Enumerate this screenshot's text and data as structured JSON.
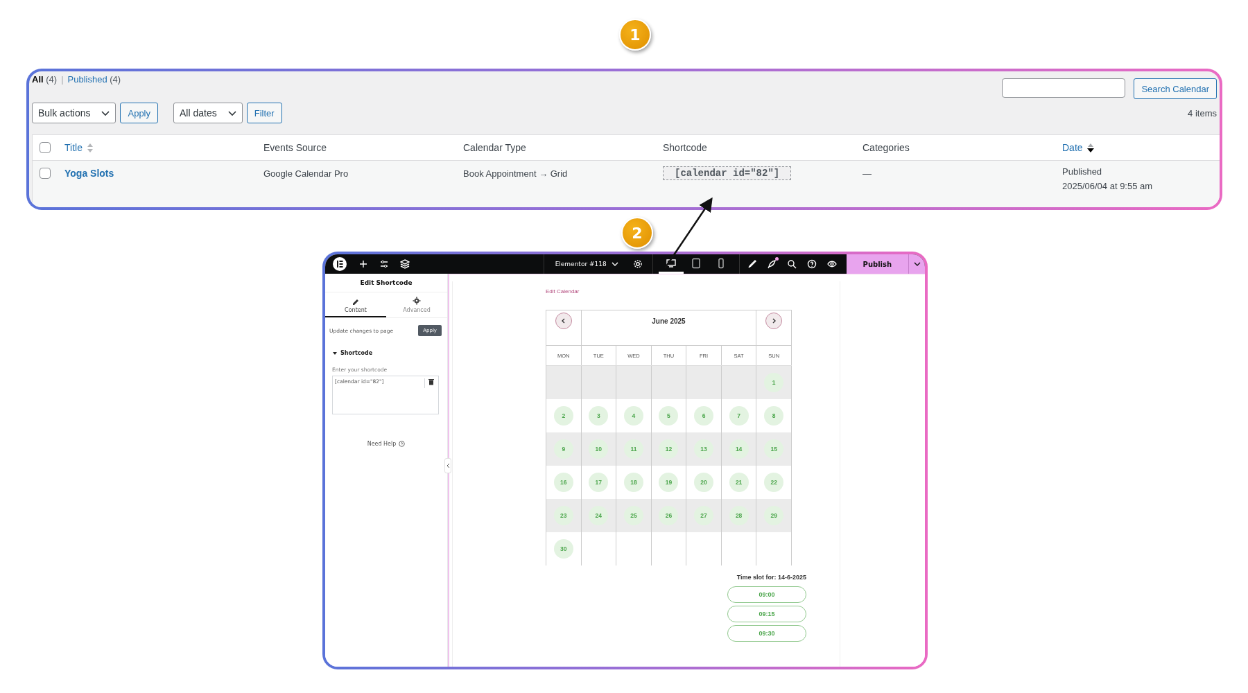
{
  "callouts": [
    {
      "number": "1"
    },
    {
      "number": "2"
    }
  ],
  "list_table": {
    "views": [
      {
        "label": "All",
        "count": "(4)",
        "selected": true
      },
      {
        "label": "Published",
        "count": "(4)",
        "selected": false
      }
    ],
    "view_separator": "|",
    "search_button": "Search Calendar",
    "bulk_select": "Bulk actions",
    "apply_button": "Apply",
    "date_select": "All dates",
    "filter_button": "Filter",
    "items_count": "4 items",
    "columns": [
      {
        "kind": "checkbox",
        "checked": false
      },
      {
        "kind": "text",
        "label": "Title",
        "sortable": true,
        "sorted": false
      },
      {
        "kind": "text",
        "label": "Events Source",
        "sortable": false
      },
      {
        "kind": "text",
        "label": "Calendar Type",
        "sortable": false
      },
      {
        "kind": "text",
        "label": "Shortcode",
        "sortable": false
      },
      {
        "kind": "text",
        "label": "Categories",
        "sortable": false
      },
      {
        "kind": "text",
        "label": "Date",
        "sortable": true,
        "sorted": true
      }
    ],
    "rows": [
      {
        "checked": false,
        "title": "Yoga Slots",
        "events_source": "Google Calendar Pro",
        "calendar_type": "Book Appointment → Grid",
        "shortcode": "[calendar id=\"82\"]",
        "categories": "—",
        "date_status": "Published",
        "date": "2025/06/04 at 9:55 am"
      }
    ]
  },
  "editor": {
    "top_bar": {
      "document_title": "Elementor #118",
      "devices": [
        {
          "kind": "desktop",
          "selected": true
        },
        {
          "kind": "tablet",
          "selected": false
        },
        {
          "kind": "mobile",
          "selected": false
        }
      ],
      "notification": true,
      "publish_button": "Publish"
    },
    "panel": {
      "title": "Edit Shortcode",
      "tabs": [
        {
          "kind": "pencil",
          "label": "Content",
          "selected": true
        },
        {
          "kind": "gear",
          "label": "Advanced",
          "selected": false
        }
      ],
      "update_label": "Update changes to page",
      "apply_button": "Apply",
      "section": {
        "title": "Shortcode",
        "expanded": true
      },
      "field_label": "Enter your shortcode",
      "field_value": "[calendar id=\"82\"]",
      "help": "Need Help"
    },
    "preview": {
      "edit_link": "Edit Calendar",
      "calendar": {
        "month": "June 2025",
        "weekdays": [
          "MON",
          "TUE",
          "WED",
          "THU",
          "FRI",
          "SAT",
          "SUN"
        ],
        "weeks": [
          {
            "shaded": true,
            "days": [
              {
                "kind": "blank"
              },
              {
                "kind": "blank"
              },
              {
                "kind": "blank"
              },
              {
                "kind": "blank"
              },
              {
                "kind": "blank"
              },
              {
                "kind": "blank"
              },
              {
                "kind": "day",
                "label": "1"
              }
            ]
          },
          {
            "shaded": false,
            "days": [
              {
                "kind": "day",
                "label": "2"
              },
              {
                "kind": "day",
                "label": "3"
              },
              {
                "kind": "day",
                "label": "4"
              },
              {
                "kind": "day",
                "label": "5"
              },
              {
                "kind": "day",
                "label": "6"
              },
              {
                "kind": "day",
                "label": "7"
              },
              {
                "kind": "day",
                "label": "8"
              }
            ]
          },
          {
            "shaded": true,
            "days": [
              {
                "kind": "day",
                "label": "9"
              },
              {
                "kind": "day",
                "label": "10"
              },
              {
                "kind": "day",
                "label": "11"
              },
              {
                "kind": "day",
                "label": "12"
              },
              {
                "kind": "day",
                "label": "13"
              },
              {
                "kind": "day",
                "label": "14"
              },
              {
                "kind": "day",
                "label": "15"
              }
            ]
          },
          {
            "shaded": false,
            "days": [
              {
                "kind": "day",
                "label": "16"
              },
              {
                "kind": "day",
                "label": "17"
              },
              {
                "kind": "day",
                "label": "18"
              },
              {
                "kind": "day",
                "label": "19"
              },
              {
                "kind": "day",
                "label": "20"
              },
              {
                "kind": "day",
                "label": "21"
              },
              {
                "kind": "day",
                "label": "22"
              }
            ]
          },
          {
            "shaded": true,
            "days": [
              {
                "kind": "day",
                "label": "23"
              },
              {
                "kind": "day",
                "label": "24"
              },
              {
                "kind": "day",
                "label": "25"
              },
              {
                "kind": "day",
                "label": "26"
              },
              {
                "kind": "day",
                "label": "27"
              },
              {
                "kind": "day",
                "label": "28"
              },
              {
                "kind": "day",
                "label": "29"
              }
            ]
          },
          {
            "shaded": false,
            "days": [
              {
                "kind": "day",
                "label": "30"
              },
              {
                "kind": "blank"
              },
              {
                "kind": "blank"
              },
              {
                "kind": "blank"
              },
              {
                "kind": "blank"
              },
              {
                "kind": "blank"
              },
              {
                "kind": "blank"
              }
            ]
          }
        ]
      },
      "time_slot_label": "Time slot for: 14-6-2025",
      "slots": [
        "09:00",
        "09:15",
        "09:30"
      ]
    }
  }
}
